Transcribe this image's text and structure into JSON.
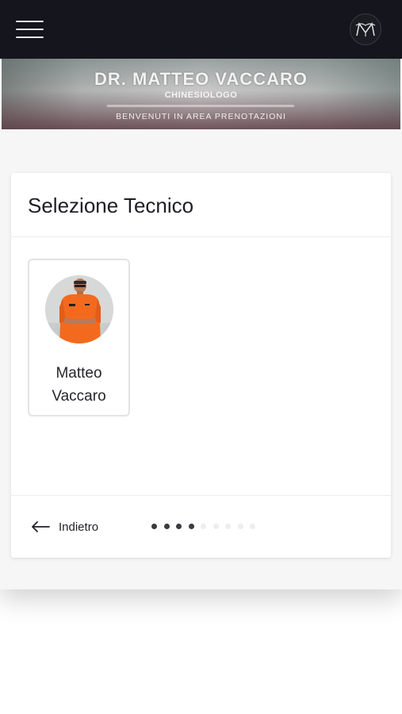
{
  "header": {
    "menu_icon": "hamburger-menu-icon",
    "logo_icon": "mv-monogram-logo"
  },
  "banner": {
    "title": "DR. MATTEO VACCARO",
    "subtitle": "CHINESIOLOGO",
    "welcome": "BENVENUTI IN AREA PRENOTAZIONI"
  },
  "card": {
    "title": "Selezione Tecnico",
    "technicians": [
      {
        "name_line1": "Matteo",
        "name_line2": "Vaccaro",
        "avatar_icon": "technician-photo"
      }
    ]
  },
  "footer": {
    "back_label": "Indietro",
    "back_icon": "arrow-left-icon",
    "steps_total": 9,
    "steps_completed": 4
  },
  "colors": {
    "topbar": "#15151e",
    "dot_active": "#3a3a40",
    "dot_inactive": "#ededf0",
    "shirt_orange": "#f36a1e"
  }
}
